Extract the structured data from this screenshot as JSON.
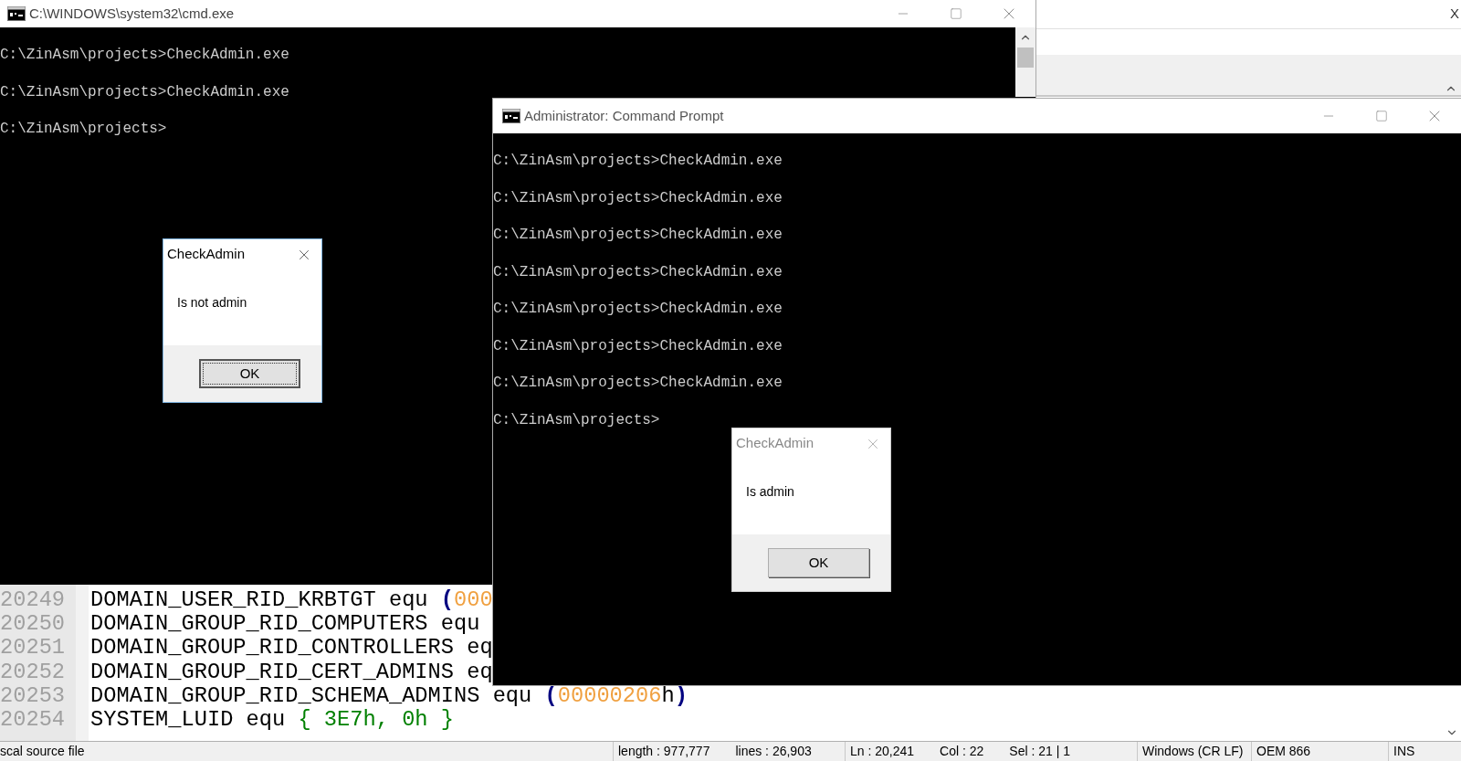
{
  "editor": {
    "close_glyph": "X",
    "lines": [
      {
        "number": "20249",
        "tokens": [
          {
            "text": "DOMAIN_USER_RID_KRBTGT equ ",
            "kind": "plain"
          },
          {
            "text": "(",
            "kind": "paren"
          },
          {
            "text": "000",
            "kind": "number"
          }
        ]
      },
      {
        "number": "20250",
        "tokens": [
          {
            "text": "DOMAIN_GROUP_RID_COMPUTERS equ",
            "kind": "plain"
          }
        ]
      },
      {
        "number": "20251",
        "tokens": [
          {
            "text": "DOMAIN_GROUP_RID_CONTROLLERS eq",
            "kind": "plain"
          }
        ]
      },
      {
        "number": "20252",
        "tokens": [
          {
            "text": "DOMAIN_GROUP_RID_CERT_ADMINS eq",
            "kind": "plain"
          }
        ]
      },
      {
        "number": "20253",
        "tokens": [
          {
            "text": "DOMAIN_GROUP_RID_SCHEMA_ADMINS equ ",
            "kind": "plain"
          },
          {
            "text": "(",
            "kind": "paren"
          },
          {
            "text": "00000206",
            "kind": "number"
          },
          {
            "text": "h",
            "kind": "plain"
          },
          {
            "text": ")",
            "kind": "paren"
          }
        ]
      },
      {
        "number": "20254",
        "tokens": [
          {
            "text": "SYSTEM_LUID equ ",
            "kind": "plain"
          },
          {
            "text": "{ 3E7h, 0h }",
            "kind": "brace"
          }
        ]
      }
    ],
    "status_bar": [
      [
        "scal source file"
      ],
      [
        "length : 977,777",
        "lines : 26,903"
      ],
      [
        "Ln : 20,241",
        "Col : 22",
        "Sel : 21 | 1"
      ],
      [
        "Windows (CR LF)"
      ],
      [
        "OEM 866"
      ],
      [
        "INS"
      ]
    ]
  },
  "cmd_window": {
    "title": "C:\\WINDOWS\\system32\\cmd.exe",
    "lines": [
      "C:\\ZinAsm\\projects>CheckAdmin.exe",
      "C:\\ZinAsm\\projects>CheckAdmin.exe",
      "C:\\ZinAsm\\projects>"
    ],
    "dialog": {
      "title": "CheckAdmin",
      "message": "Is not admin",
      "button": "OK",
      "active": true,
      "focused": true
    }
  },
  "admin_window": {
    "title": "Administrator: Command Prompt",
    "lines": [
      "C:\\ZinAsm\\projects>CheckAdmin.exe",
      "C:\\ZinAsm\\projects>CheckAdmin.exe",
      "C:\\ZinAsm\\projects>CheckAdmin.exe",
      "C:\\ZinAsm\\projects>CheckAdmin.exe",
      "C:\\ZinAsm\\projects>CheckAdmin.exe",
      "C:\\ZinAsm\\projects>CheckAdmin.exe",
      "C:\\ZinAsm\\projects>CheckAdmin.exe",
      "C:\\ZinAsm\\projects>"
    ],
    "dialog": {
      "title": "CheckAdmin",
      "message": "Is admin",
      "button": "OK",
      "active": false,
      "focused": false
    }
  }
}
